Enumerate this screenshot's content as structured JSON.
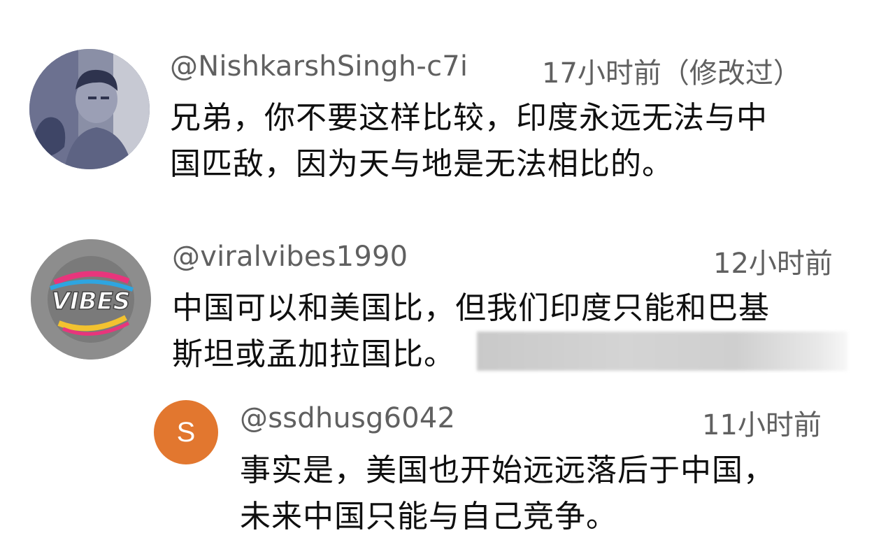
{
  "comments": [
    {
      "handle": "@NishkarshSingh-c7i",
      "time": "17小时前（修改过）",
      "line1": "兄弟，你不要这样比较，印度永远无法与中",
      "line2": "国匹敌，因为天与地是无法相比的。",
      "avatar_icon": "person-photo-icon"
    },
    {
      "handle": "@viralvibes1990",
      "time": "12小时前",
      "line1": "中国可以和美国比，但我们印度只能和巴基",
      "line2": "斯坦或孟加拉国比。",
      "avatar_icon": "vibes-logo-icon"
    }
  ],
  "reply": {
    "handle": "@ssdhusg6042",
    "time": "11小时前",
    "avatar_letter": "S",
    "avatar_color": "#e2772f",
    "line1": "事实是，美国也开始远远落后于中国，",
    "line2": "未来中国只能与自己竞争。"
  }
}
